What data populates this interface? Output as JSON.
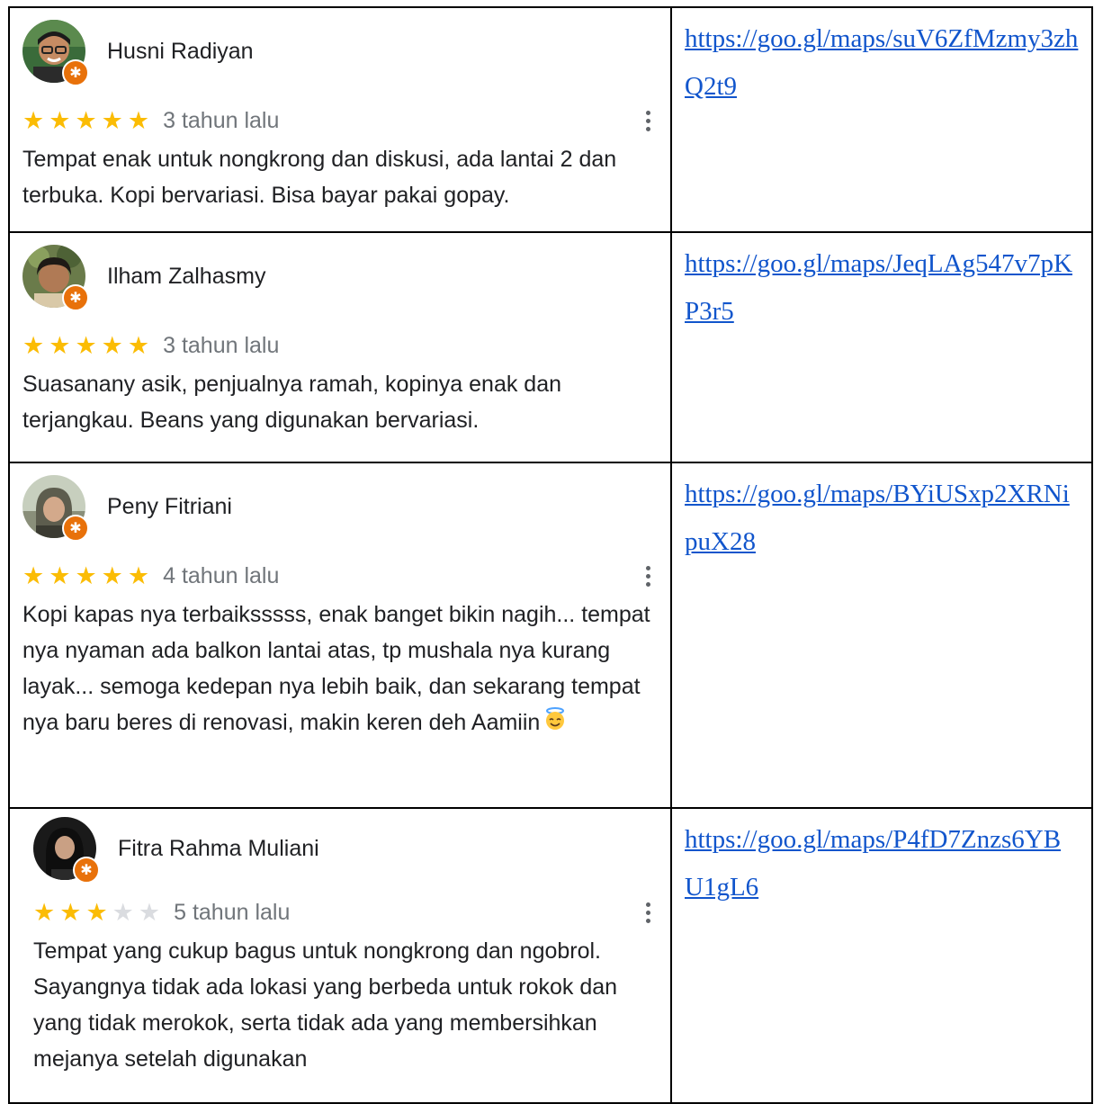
{
  "reviews": [
    {
      "name": "Husni Radiyan",
      "stars": 5,
      "time": "3 tahun lalu",
      "text": "Tempat enak untuk nongkrong dan diskusi, ada lantai 2 dan terbuka. Kopi bervariasi. Bisa bayar pakai gopay.",
      "link": "https://goo.gl/maps/suV6ZfMzmy3zhQ2t9"
    },
    {
      "name": "Ilham Zalhasmy",
      "stars": 5,
      "time": "3 tahun lalu",
      "text": "Suasanany asik, penjualnya ramah, kopinya enak dan terjangkau. Beans yang digunakan bervariasi.",
      "link": "https://goo.gl/maps/JeqLAg547v7pKP3r5"
    },
    {
      "name": "Peny Fitriani",
      "stars": 5,
      "time": "4 tahun lalu",
      "text": "Kopi kapas nya terbaiksssss,  enak banget bikin nagih... tempat nya nyaman ada balkon lantai atas, tp mushala nya kurang layak... semoga kedepan nya lebih baik, dan sekarang tempat nya baru beres di renovasi,  makin keren deh  Aamiin",
      "link": "https://goo.gl/maps/BYiUSxp2XRNipuX28"
    },
    {
      "name": "Fitra Rahma Muliani",
      "stars": 3,
      "time": "5 tahun lalu",
      "text": "Tempat yang cukup bagus untuk nongkrong dan ngobrol. Sayangnya tidak ada lokasi yang berbeda untuk rokok dan yang tidak merokok, serta tidak ada yang membersihkan mejanya setelah digunakan",
      "link": "https://goo.gl/maps/P4fD7Znzs6YBU1gL6"
    }
  ],
  "icons": {
    "star": "star-icon",
    "more": "more-vert-icon",
    "badge": "local-guide-badge-icon",
    "emoji": "smiling-face-with-halo-emoji"
  },
  "colors": {
    "star_on": "#fbbc04",
    "star_off": "#dadce0",
    "link": "#1155cc",
    "badge": "#e8710a"
  }
}
